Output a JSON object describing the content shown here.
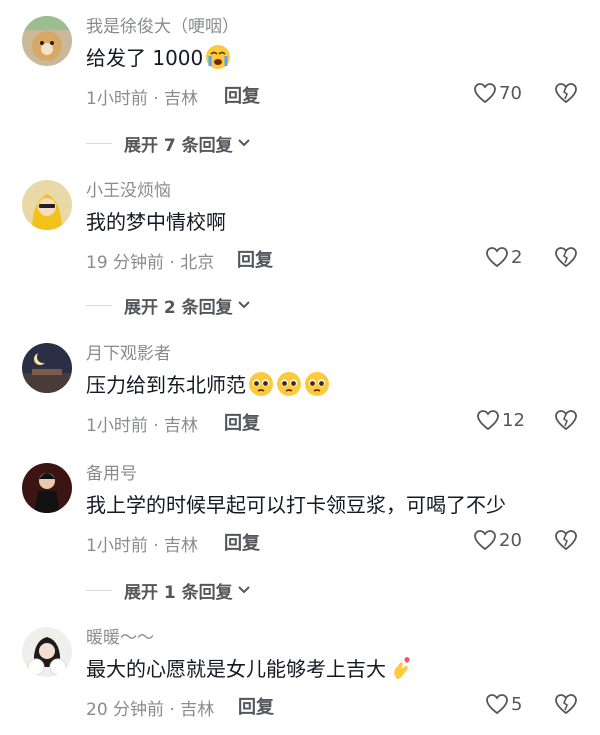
{
  "comments": [
    {
      "username": "我是徐俊大（哽咽）",
      "text": "给发了 1000",
      "emoji": "crying-face",
      "meta": "1小时前 · 吉林",
      "reply": "回复",
      "likes": "70",
      "expand": "展开 7 条回复"
    },
    {
      "username": "小王没烦恼",
      "text": "我的梦中情校啊",
      "meta": "19 分钟前 · 北京",
      "reply": "回复",
      "likes": "2",
      "expand": "展开 2 条回复"
    },
    {
      "username": "月下观影者",
      "text": "压力给到东北师范",
      "emoji": "pleading-face",
      "meta": "1小时前 · 吉林",
      "reply": "回复",
      "likes": "12"
    },
    {
      "username": "备用号",
      "text": "我上学的时候早起可以打卡领豆浆，可喝了不少",
      "meta": "1小时前 · 吉林",
      "reply": "回复",
      "likes": "20",
      "expand": "展开 1 条回复"
    },
    {
      "username": "暖暖～～",
      "text": "最大的心愿就是女儿能够考上吉大",
      "emoji": "finger-heart",
      "meta": "20 分钟前 · 吉林",
      "reply": "回复",
      "likes": "5"
    }
  ]
}
